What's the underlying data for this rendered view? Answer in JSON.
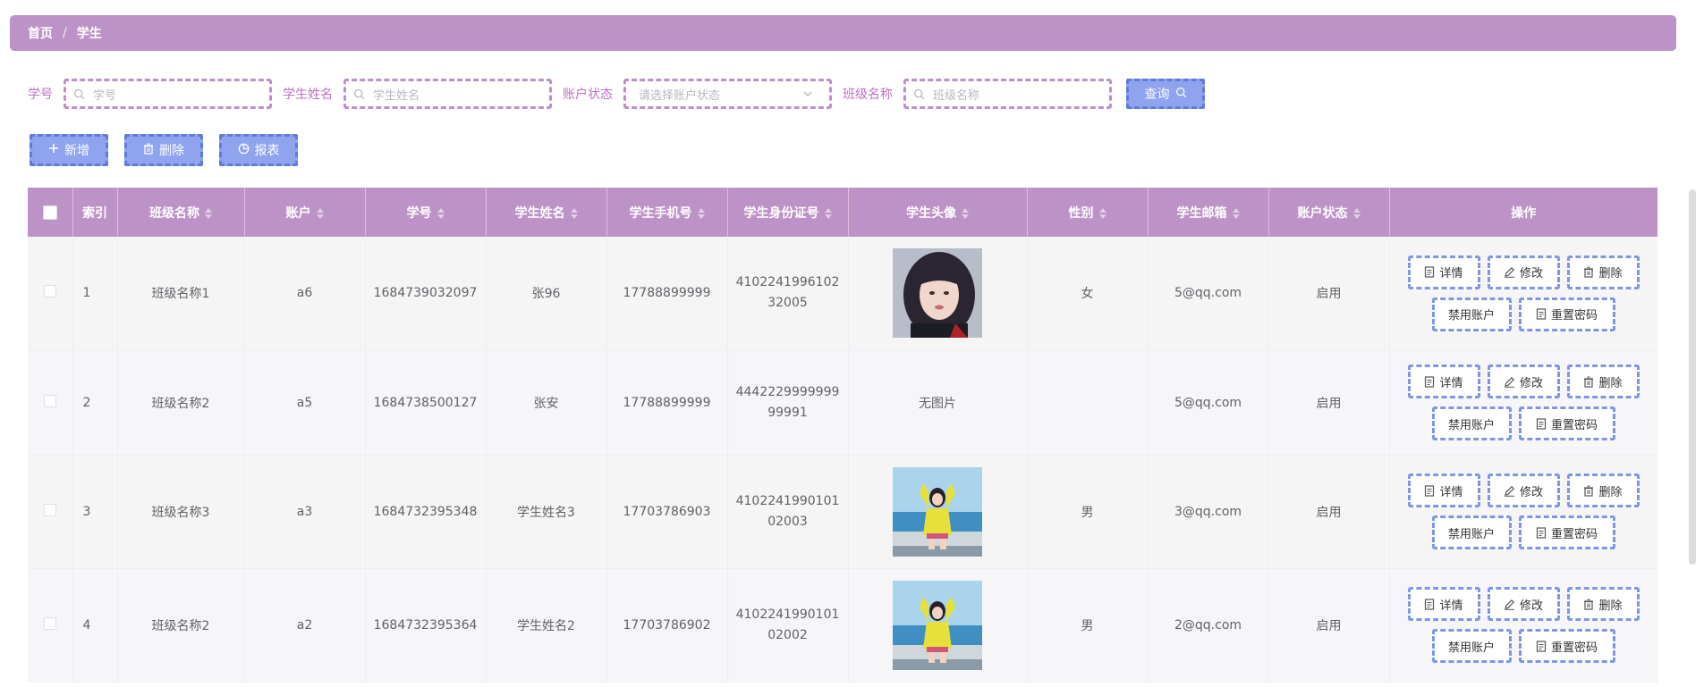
{
  "breadcrumb": {
    "home": "首页",
    "separator": "/",
    "current": "学生"
  },
  "search": {
    "student_no_label": "学号",
    "student_no_placeholder": "学号",
    "student_name_label": "学生姓名",
    "student_name_placeholder": "学生姓名",
    "account_status_label": "账户状态",
    "account_status_placeholder": "请选择账户状态",
    "class_name_label": "班级名称",
    "class_name_placeholder": "班级名称",
    "query_label": "查询"
  },
  "toolbar": {
    "add_label": "新增",
    "delete_label": "删除",
    "report_label": "报表"
  },
  "table": {
    "columns": {
      "index": "索引",
      "class_name": "班级名称",
      "account": "账户",
      "student_no": "学号",
      "student_name": "学生姓名",
      "phone": "学生手机号",
      "id_card": "学生身份证号",
      "avatar": "学生头像",
      "gender": "性别",
      "email": "学生邮箱",
      "account_status": "账户状态",
      "actions": "操作"
    },
    "actions": {
      "detail": "详情",
      "edit": "修改",
      "delete": "删除",
      "disable": "禁用账户",
      "reset": "重置密码"
    },
    "rows": [
      {
        "index": "1",
        "class_name": "班级名称1",
        "account": "a6",
        "student_no": "1684739032097",
        "student_name": "张96",
        "phone": "17788899999",
        "id_card": "410224199610232005",
        "avatar": "photo-portrait",
        "gender": "女",
        "email": "5@qq.com",
        "account_status": "启用"
      },
      {
        "index": "2",
        "class_name": "班级名称2",
        "account": "a5",
        "student_no": "1684738500127",
        "student_name": "张安",
        "phone": "17788899999",
        "id_card": "444222999999999991",
        "avatar": "无图片",
        "gender": "",
        "email": "5@qq.com",
        "account_status": "启用"
      },
      {
        "index": "3",
        "class_name": "班级名称3",
        "account": "a3",
        "student_no": "1684732395348",
        "student_name": "学生姓名3",
        "phone": "17703786903",
        "id_card": "410224199010102003",
        "avatar": "photo-beach",
        "gender": "男",
        "email": "3@qq.com",
        "account_status": "启用"
      },
      {
        "index": "4",
        "class_name": "班级名称2",
        "account": "a2",
        "student_no": "1684732395364",
        "student_name": "学生姓名2",
        "phone": "17703786902",
        "id_card": "410224199010102002",
        "avatar": "photo-beach",
        "gender": "男",
        "email": "2@qq.com",
        "account_status": "启用"
      }
    ]
  },
  "colors": {
    "header": "#bd93c7",
    "button": "#8fa3ee",
    "button_border": "#5e7bdc",
    "label": "#bd72c2"
  }
}
